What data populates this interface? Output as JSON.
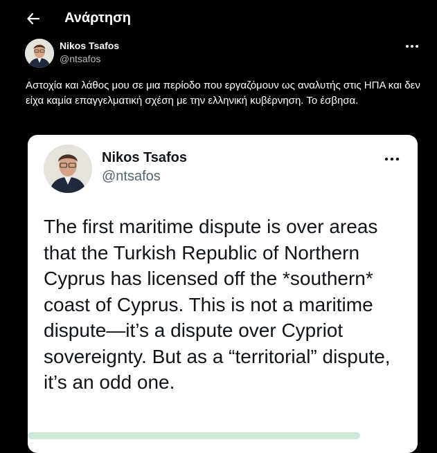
{
  "header": {
    "title": "Ανάρτηση",
    "back_icon": "arrow-left-icon"
  },
  "post": {
    "author_name": "Nikos Tsafos",
    "author_handle": "@ntsafos",
    "text": "Αστοχία και λάθος μου σε μια περίοδο που εργαζόμουν ως αναλυτής στις ΗΠΑ και δεν είχα καμία επαγγελματική σχέση με την ελληνική κυβέρνηση. Το έσβησα.",
    "more_icon": "more-horizontal-icon"
  },
  "quoted": {
    "author_name": "Nikos Tsafos",
    "author_handle": "@ntsafos",
    "text": "The first maritime dispute is over areas that the Turkish Republic of Northern Cyprus has licensed off the *southern* coast of Cyprus. This is not a maritime dispute—it’s a dispute over Cypriot sovereignty. But as a “territorial” dispute, it’s an odd one.",
    "more_icon": "more-horizontal-icon"
  },
  "colors": {
    "background": "#000000",
    "card": "#ffffff",
    "secondary_text": "#536471"
  }
}
